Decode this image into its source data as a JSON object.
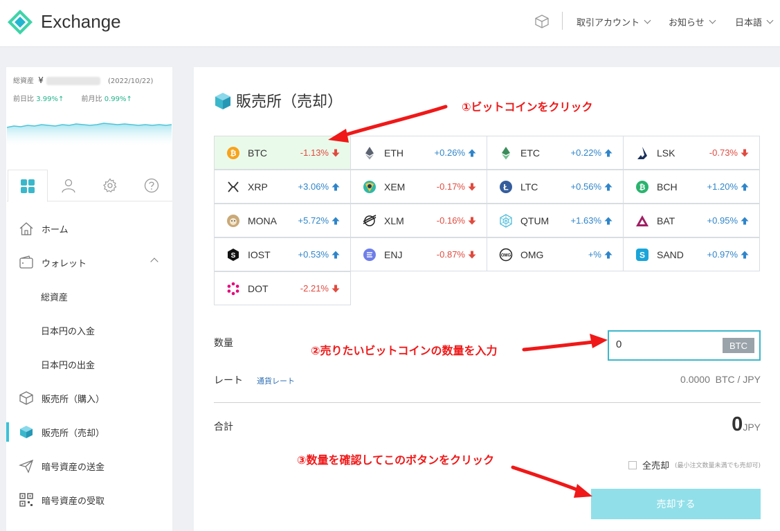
{
  "header": {
    "brand": "Exchange",
    "menu": [
      {
        "label": "取引アカウント"
      },
      {
        "label": "お知らせ"
      },
      {
        "label": "日本語"
      }
    ]
  },
  "sidebar": {
    "assets_label": "総資産",
    "yen": "¥",
    "date": "(2022/10/22)",
    "day_label": "前日比",
    "day_value": "3.99%↑",
    "month_label": "前月比",
    "month_value": "0.99%↑",
    "nav": [
      {
        "label": "ホーム",
        "icon": "home-icon"
      },
      {
        "label": "ウォレット",
        "icon": "wallet-icon"
      },
      {
        "label": "総資産"
      },
      {
        "label": "日本円の入金"
      },
      {
        "label": "日本円の出金"
      },
      {
        "label": "販売所（購入）",
        "icon": "cube-icon"
      },
      {
        "label": "販売所（売却）",
        "icon": "cube-solid-icon"
      },
      {
        "label": "暗号資産の送金",
        "icon": "send-icon"
      },
      {
        "label": "暗号資産の受取",
        "icon": "qr-icon"
      }
    ]
  },
  "main": {
    "title": "販売所（売却）",
    "coins": [
      {
        "symbol": "BTC",
        "change": "-1.13%",
        "dir": "down",
        "color": "#f7a31c"
      },
      {
        "symbol": "ETH",
        "change": "+0.26%",
        "dir": "up",
        "color": "#5b6270"
      },
      {
        "symbol": "ETC",
        "change": "+0.22%",
        "dir": "up",
        "color": "#3b8c5a"
      },
      {
        "symbol": "LSK",
        "change": "-0.73%",
        "dir": "down",
        "color": "#1a2f5a"
      },
      {
        "symbol": "XRP",
        "change": "+3.06%",
        "dir": "up",
        "color": "#333333"
      },
      {
        "symbol": "XEM",
        "change": "-0.17%",
        "dir": "down",
        "color": "#2fb9a8"
      },
      {
        "symbol": "LTC",
        "change": "+0.56%",
        "dir": "up",
        "color": "#345d9d"
      },
      {
        "symbol": "BCH",
        "change": "+1.20%",
        "dir": "up",
        "color": "#2bb36e"
      },
      {
        "symbol": "MONA",
        "change": "+5.72%",
        "dir": "up",
        "color": "#c9a978"
      },
      {
        "symbol": "XLM",
        "change": "-0.16%",
        "dir": "down",
        "color": "#222222"
      },
      {
        "symbol": "QTUM",
        "change": "+1.63%",
        "dir": "up",
        "color": "#3fb8d9"
      },
      {
        "symbol": "BAT",
        "change": "+0.95%",
        "dir": "up",
        "color": "#9e1f63"
      },
      {
        "symbol": "IOST",
        "change": "+0.53%",
        "dir": "up",
        "color": "#111111"
      },
      {
        "symbol": "ENJ",
        "change": "-0.87%",
        "dir": "down",
        "color": "#6f7ee8"
      },
      {
        "symbol": "OMG",
        "change": "+%",
        "dir": "up",
        "color": "#222222"
      },
      {
        "symbol": "SAND",
        "change": "+0.97%",
        "dir": "up",
        "color": "#1aa5d8"
      },
      {
        "symbol": "DOT",
        "change": "-2.21%",
        "dir": "down",
        "color": "#e6007a"
      }
    ],
    "qty_label": "数量",
    "qty_value": "0",
    "qty_unit": "BTC",
    "rate_label": "レート",
    "rate_link": "通貨レート",
    "rate_value": "0.0000",
    "rate_unit": "BTC / JPY",
    "total_label": "合計",
    "total_value": "0",
    "total_unit": "JPY",
    "sell_all_label": "全売却",
    "sell_all_note": "(最小注文数量未満でも売却可)",
    "sell_button": "売却する"
  },
  "annotations": {
    "step1": "①ビットコインをクリック",
    "step2": "②売りたいビットコインの数量を入力",
    "step3": "③数量を確認してこのボタンをクリック"
  },
  "colors": {
    "accent": "#3bc1d8",
    "up": "#2f85c9",
    "down": "#e04b3f",
    "annotation": "#f01818",
    "selected_cell": "#eafaea",
    "button": "#91dfe9"
  }
}
